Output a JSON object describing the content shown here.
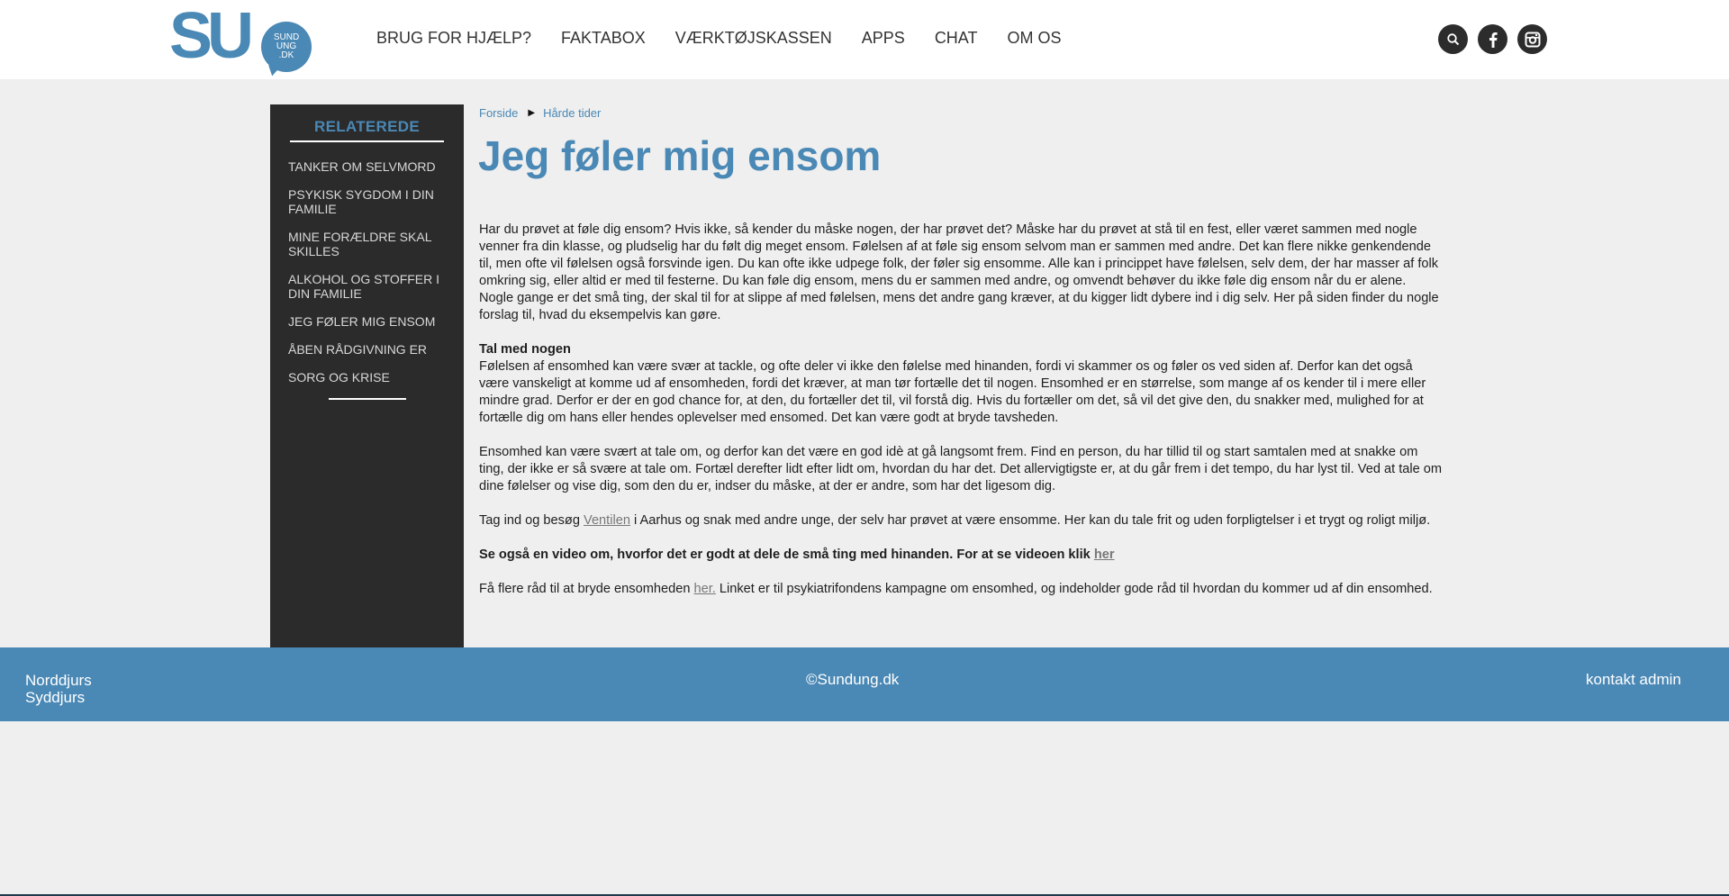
{
  "logo": {
    "main": "SU",
    "bubble_lines": [
      "SUND",
      "UNG",
      ".DK"
    ]
  },
  "nav": {
    "items": [
      "BRUG FOR HJÆLP?",
      "FAKTABOX",
      "VÆRKTØJSKASSEN",
      "APPS",
      "CHAT",
      "OM OS"
    ]
  },
  "social": {
    "icons": [
      "search-icon",
      "facebook-icon",
      "instagram-icon"
    ]
  },
  "sidebar": {
    "title": "RELATEREDE",
    "items": [
      "TANKER OM SELVMORD",
      "PSYKISK SYGDOM I DIN FAMILIE",
      "MINE FORÆLDRE SKAL SKILLES",
      "ALKOHOL OG STOFFER I DIN FAMILIE",
      "JEG FØLER MIG ENSOM",
      "ÅBEN RÅDGIVNING ER",
      "SORG OG KRISE"
    ]
  },
  "breadcrumb": {
    "home": "Forside",
    "current": "Hårde tider"
  },
  "page": {
    "title": "Jeg føler mig ensom",
    "p1": "Har du prøvet at føle dig ensom? Hvis ikke, så kender du måske nogen, der har prøvet det? Måske har du prøvet at stå til en fest, eller været sammen med nogle venner fra din klasse, og pludselig har du følt dig meget ensom. Følelsen af at føle sig ensom selvom man er sammen med andre. Det kan flere nikke genkendende til, men ofte vil følelsen også forsvinde igen. Du kan ofte ikke udpege folk, der føler sig ensomme. Alle kan i princippet have følelsen, selv dem, der har masser af folk omkring sig, eller altid er med til festerne. Du kan føle dig ensom, mens du er sammen med andre, og omvendt behøver du ikke føle dig ensom når du er alene. Nogle gange er det små ting, der skal til for at slippe af med følelsen, mens det andre gang kræver, at du kigger lidt dybere ind i dig selv. Her på siden finder du nogle forslag til, hvad du eksempelvis kan gøre.",
    "h2": "Tal med nogen",
    "p2": "Følelsen af ensomhed kan være svær at tackle, og ofte deler vi ikke den følelse med hinanden, fordi vi skammer os og føler os ved siden af. Derfor kan det også være vanskeligt at komme ud af ensomheden, fordi det kræver, at man tør fortælle det til nogen. Ensomhed er en størrelse, som mange af os kender til i mere eller mindre grad. Derfor er der en god chance for, at den, du fortæller det til, vil forstå dig. Hvis du fortæller om det, så vil det give den, du snakker med, mulighed for at fortælle dig om hans eller hendes oplevelser med ensomed. Det kan være godt at bryde tavsheden.",
    "p3": "Ensomhed kan være svært at tale om, og derfor kan det være en god idè at gå langsomt frem. Find en person, du har tillid til og start samtalen med at snakke om ting, der ikke er så svære at tale om. Fortæl derefter lidt efter lidt om, hvordan du har det. Det allervigtigste er, at du går frem i det tempo, du har lyst til. Ved at tale om dine følelser og vise dig, som den du er, indser du måske, at der er andre, som har det ligesom dig.",
    "p4_before": "Tag ind og besøg ",
    "p4_link": "Ventilen",
    "p4_after": " i Aarhus og snak med andre unge, der selv har prøvet at være ensomme. Her kan du tale frit og uden forpligtelser i et trygt og roligt miljø.",
    "p5_before": "Se også en video om, hvorfor det er godt at dele de små ting med hinanden. For at se videoen klik ",
    "p5_link": "her",
    "p6_before": "Få flere råd til at bryde ensomheden ",
    "p6_link": "her.",
    "p6_after": " Linket er til psykiatrifondens kampagne om ensomhed, og indeholder gode råd til hvordan du kommer ud af din ensomhed."
  },
  "footer": {
    "region1": "Norddjurs",
    "region2": "Syddjurs",
    "copyright": "©Sundung.dk",
    "admin": "kontakt admin"
  },
  "colors": {
    "accent": "#4a88b5",
    "sidebar_bg": "#2b2b2b",
    "page_bg": "#efefef"
  }
}
